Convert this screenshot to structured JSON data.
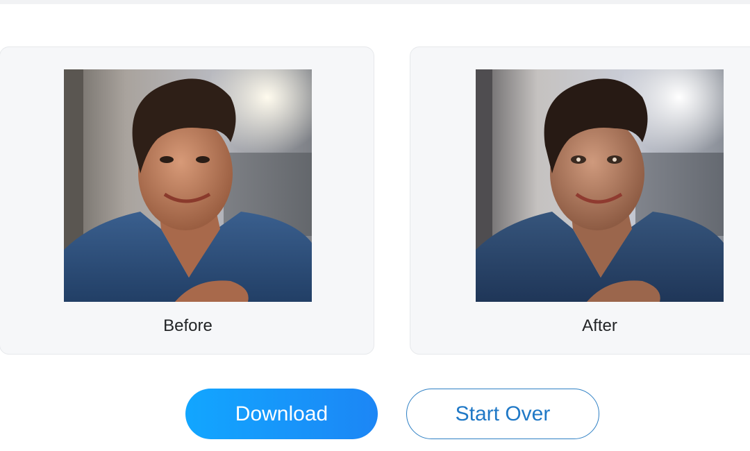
{
  "comparison": {
    "before": {
      "label": "Before",
      "image_icon": "portrait-photo-original"
    },
    "after": {
      "label": "After",
      "image_icon": "portrait-photo-enhanced"
    }
  },
  "actions": {
    "download_label": "Download",
    "start_over_label": "Start Over"
  },
  "colors": {
    "primary": "#1c86f5",
    "primary_light": "#12a6ff",
    "outline_text": "#1f78c6",
    "card_bg": "#f6f7f9"
  }
}
